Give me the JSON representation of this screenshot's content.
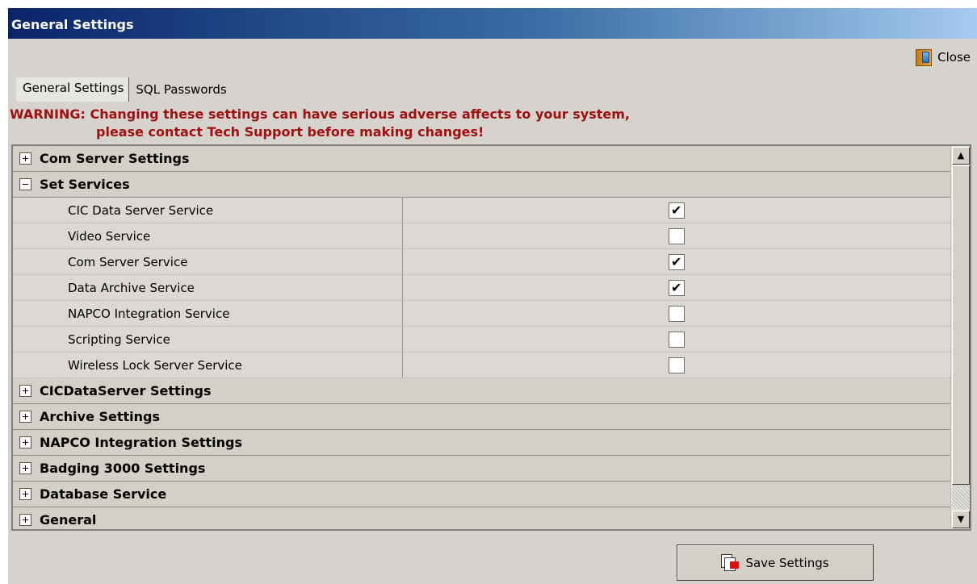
{
  "window": {
    "title": "General Settings"
  },
  "toolbar": {
    "close_label": "Close"
  },
  "tabs": [
    {
      "label": "General Settings",
      "active": true
    },
    {
      "label": "SQL Passwords",
      "active": false
    }
  ],
  "warning": {
    "line1": "WARNING: Changing these settings can have serious adverse affects to your system,",
    "line2": "please contact Tech Support before making changes!",
    "color": "#a01010"
  },
  "grid": {
    "categories": [
      {
        "label": "Com Server Settings",
        "expanded": false
      },
      {
        "label": "Set Services",
        "expanded": true,
        "properties": [
          {
            "name": "CIC Data Server Service",
            "checked": true
          },
          {
            "name": "Video Service",
            "checked": false
          },
          {
            "name": "Com Server Service",
            "checked": true
          },
          {
            "name": "Data Archive Service",
            "checked": true
          },
          {
            "name": "NAPCO Integration Service",
            "checked": false
          },
          {
            "name": "Scripting Service",
            "checked": false
          },
          {
            "name": "Wireless Lock Server Service",
            "checked": false
          }
        ]
      },
      {
        "label": "CICDataServer Settings",
        "expanded": false
      },
      {
        "label": "Archive Settings",
        "expanded": false
      },
      {
        "label": "NAPCO Integration Settings",
        "expanded": false
      },
      {
        "label": "Badging 3000 Settings",
        "expanded": false
      },
      {
        "label": "Database Service",
        "expanded": false
      },
      {
        "label": "General",
        "expanded": false
      }
    ]
  },
  "footer": {
    "save_label": "Save Settings"
  }
}
